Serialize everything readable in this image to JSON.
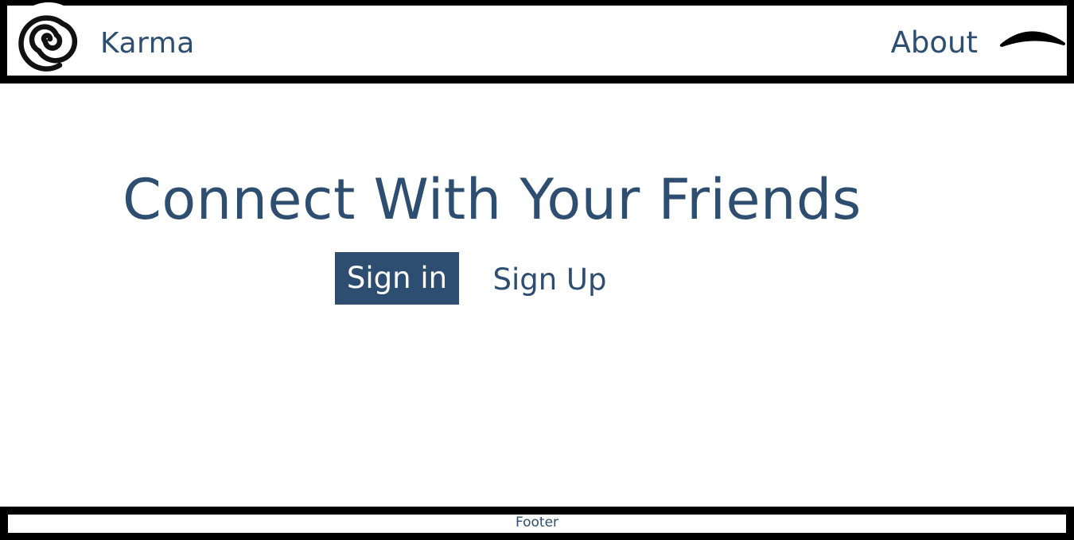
{
  "header": {
    "brand": "Karma",
    "logo_icon": "spiral-icon",
    "nav_about": "About",
    "menu_icon": "eye-arc-icon"
  },
  "hero": {
    "title": "Connect With Your Friends",
    "signin_label": "Sign in",
    "signup_label": "Sign Up"
  },
  "footer": {
    "text": "Footer"
  },
  "colors": {
    "primary": "#2d4e70",
    "border": "#000000",
    "background": "#ffffff"
  }
}
